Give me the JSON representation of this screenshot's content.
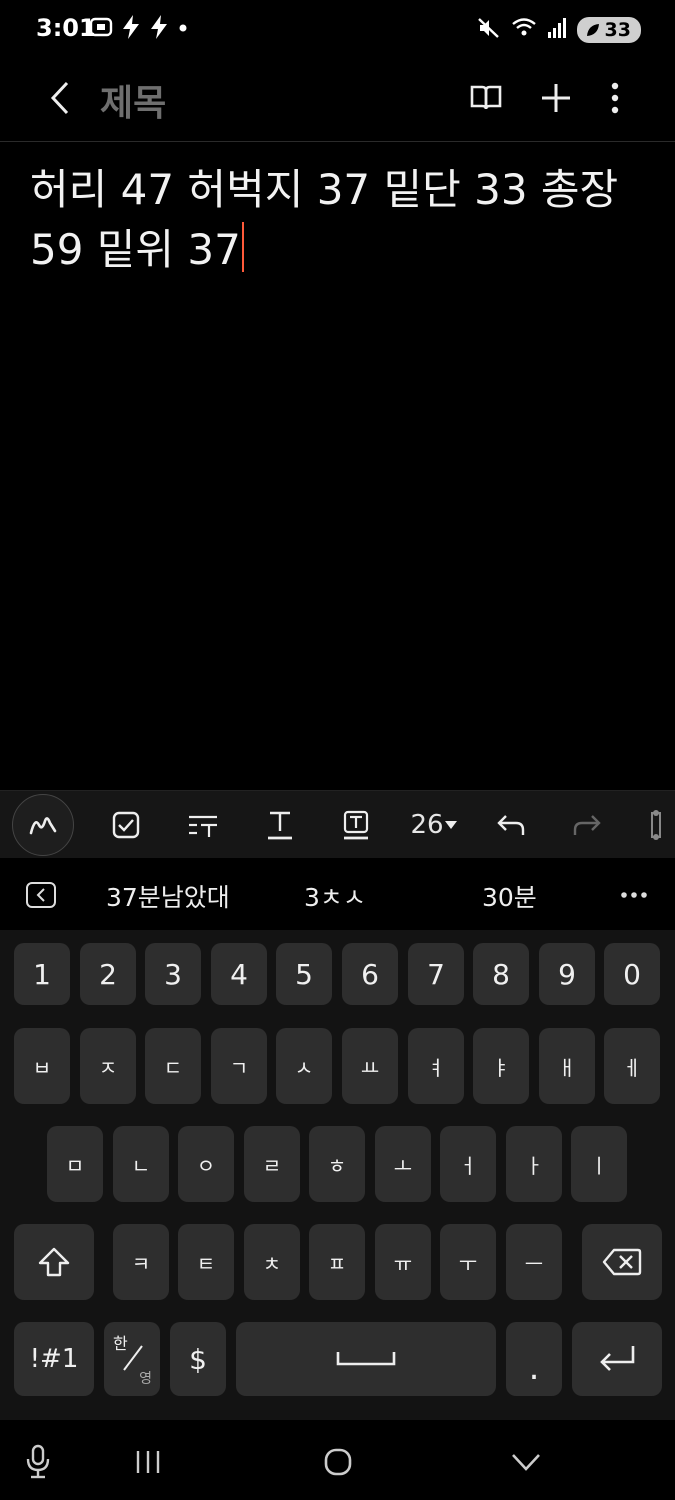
{
  "status_bar": {
    "time": "3:01",
    "battery_level": "33"
  },
  "header": {
    "title": "제목"
  },
  "note": {
    "line1": "허리 47 허벅지 37 밑단 33 총장",
    "line2": "59 밑위 37"
  },
  "toolbar": {
    "font_size": "26"
  },
  "suggestions": [
    "37분남았대",
    "3ㅊㅅ",
    "30분"
  ],
  "keyboard": {
    "numbers": [
      "1",
      "2",
      "3",
      "4",
      "5",
      "6",
      "7",
      "8",
      "9",
      "0"
    ],
    "row1": [
      "ㅂ",
      "ㅈ",
      "ㄷ",
      "ㄱ",
      "ㅅ",
      "ㅛ",
      "ㅕ",
      "ㅑ",
      "ㅐ",
      "ㅔ"
    ],
    "row2": [
      "ㅁ",
      "ㄴ",
      "ㅇ",
      "ㄹ",
      "ㅎ",
      "ㅗ",
      "ㅓ",
      "ㅏ",
      "ㅣ"
    ],
    "row3": [
      "ㅋ",
      "ㅌ",
      "ㅊ",
      "ㅍ",
      "ㅠ",
      "ㅜ",
      "ㅡ"
    ],
    "symbols_label": "!#1",
    "lang_top": "한",
    "lang_bottom": "영",
    "currency_label": "$",
    "period_label": "."
  },
  "colors": {
    "background": "#000000",
    "key": "#2e2e2e",
    "caret": "#ff5a3a",
    "title": "#6f6f6f"
  }
}
